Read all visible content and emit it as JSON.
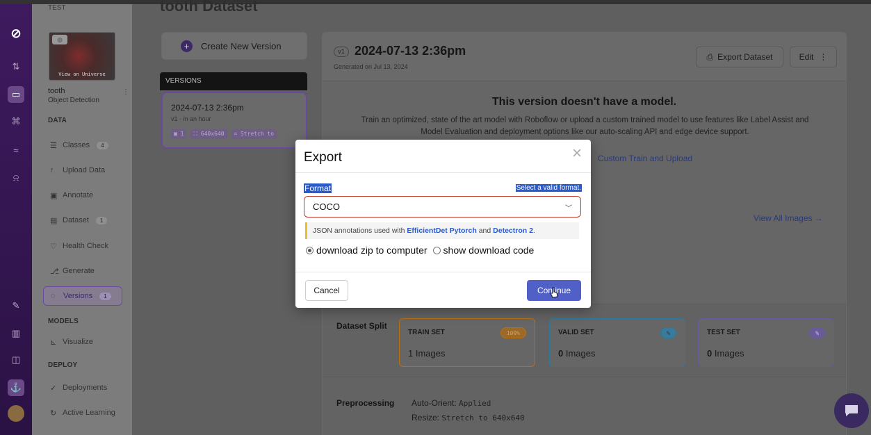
{
  "sidebar": {
    "project_label": "TEST",
    "view_on_universe": "View on Universe",
    "project_name": "tooth",
    "project_type": "Object Detection",
    "data_section": "DATA",
    "models_section": "MODELS",
    "deploy_section": "DEPLOY",
    "items": [
      {
        "label": "Classes",
        "count": "4",
        "icon": "list-icon"
      },
      {
        "label": "Upload Data",
        "icon": "upload-icon"
      },
      {
        "label": "Annotate",
        "icon": "annotate-icon"
      },
      {
        "label": "Dataset",
        "count": "1",
        "icon": "dataset-icon"
      },
      {
        "label": "Health Check",
        "icon": "health-check-icon"
      },
      {
        "label": "Generate",
        "icon": "generate-icon"
      },
      {
        "label": "Versions",
        "count": "1",
        "icon": "versions-icon"
      },
      {
        "label": "Visualize",
        "icon": "visualize-icon"
      },
      {
        "label": "Deployments",
        "icon": "deployments-icon"
      },
      {
        "label": "Active Learning",
        "icon": "active-learning-icon"
      }
    ]
  },
  "main": {
    "page_title_fragment": "tooth Dataset",
    "create_version_label": "Create New Version",
    "versions_header": "VERSIONS",
    "version_card": {
      "title": "2024-07-13 2:36pm",
      "subtitle": "v1 · in an hour",
      "tags": [
        "1",
        "640x640",
        "Stretch to"
      ]
    },
    "detail": {
      "version_pill": "v1",
      "title": "2024-07-13 2:36pm",
      "generated": "Generated on Jul 13, 2024",
      "export_label": "Export Dataset",
      "edit_label": "Edit",
      "no_model_title": "This version doesn't have a model.",
      "no_model_desc": "Train an optimized, state of the art model with Roboflow or upload a custom trained model to use features like Label Assist and Model Evaluation and deployment options like our auto-scaling API and edge device support.",
      "custom_train": "Custom Train and Upload",
      "view_all": "View All Images →",
      "split_label": "Dataset Split",
      "train": {
        "label": "TRAIN SET",
        "badge": "100%",
        "count": "1",
        "unit": "Images"
      },
      "valid": {
        "label": "VALID SET",
        "badge": "%",
        "count": "0",
        "unit": "Images"
      },
      "test": {
        "label": "TEST SET",
        "badge": "%",
        "count": "0",
        "unit": "Images"
      },
      "preprocessing_label": "Preprocessing",
      "prep_orient_key": "Auto-Orient:",
      "prep_orient_val": "Applied",
      "prep_resize_key": "Resize:",
      "prep_resize_val": "Stretch to 640x640"
    }
  },
  "modal": {
    "title": "Export",
    "format_label": "Format",
    "format_error": "Select a valid format.",
    "format_value": "COCO",
    "hint_prefix": "JSON annotations used with",
    "hint_link1": "EfficientDet Pytorch",
    "hint_and": "and",
    "hint_link2": "Detectron 2",
    "hint_suffix": ".",
    "radio_zip": "download zip to computer",
    "radio_code": "show download code",
    "cancel_label": "Cancel",
    "continue_label": "Continue"
  },
  "colors": {
    "accent": "#5160c6",
    "error": "#c0392b",
    "selection": "#2a59c8",
    "train_badge": "#b8700f",
    "valid_badge": "#2a7a9a",
    "test_badge": "#6a5a9a"
  }
}
